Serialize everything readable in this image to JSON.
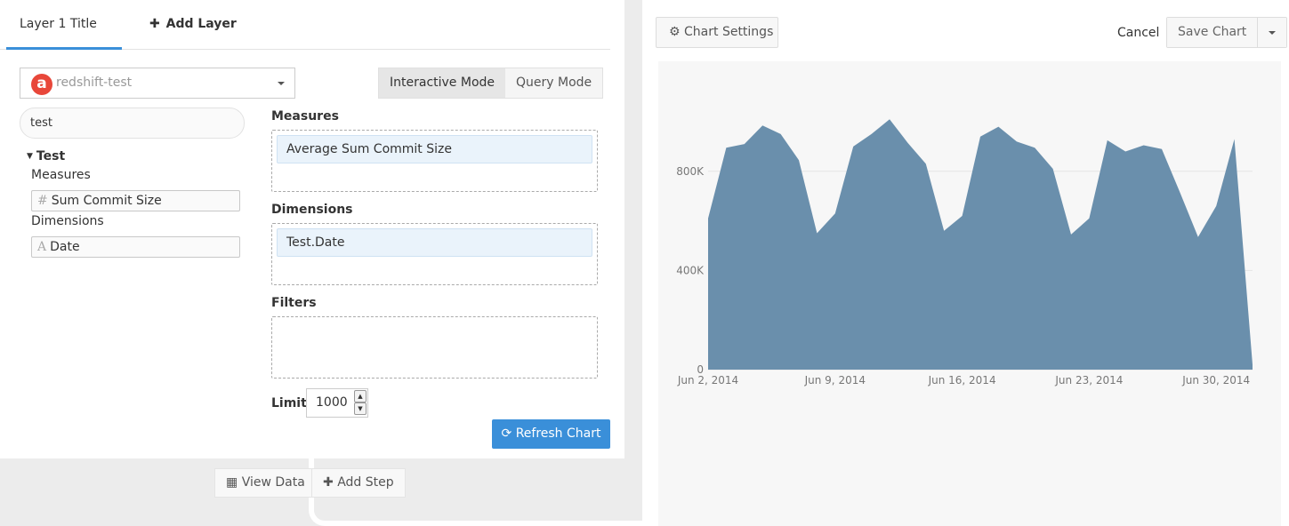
{
  "tabs": {
    "active_label": "Layer 1 Title",
    "add_label": "Add Layer"
  },
  "source": {
    "logo_letter": "a",
    "name": "redshift-test"
  },
  "modes": {
    "interactive": "Interactive Mode",
    "query": "Query Mode",
    "active": "interactive"
  },
  "search": {
    "value": "test"
  },
  "schema": {
    "table": "Test",
    "measures_heading": "Measures",
    "measure_field": "Sum Commit Size",
    "measure_icon": "#",
    "dimensions_heading": "Dimensions",
    "dimension_field": "Date",
    "dimension_icon": "A"
  },
  "query": {
    "measures_title": "Measures",
    "measure_item": "Average Sum Commit Size",
    "dimensions_title": "Dimensions",
    "dimension_item": "Test.Date",
    "filters_title": "Filters",
    "limit_label": "Limit",
    "limit_value": "1000",
    "refresh_label": "Refresh Chart"
  },
  "steps": {
    "view_data": "View Data",
    "add_step": "Add Step"
  },
  "toolbar": {
    "settings": "Chart Settings",
    "cancel": "Cancel",
    "save": "Save Chart"
  },
  "colors": {
    "accent": "#3a8fd9",
    "area_fill": "#6a8fac",
    "logo": "#e8473a"
  },
  "chart_data": {
    "type": "area",
    "x": [
      "2014-06-02",
      "2014-06-03",
      "2014-06-04",
      "2014-06-05",
      "2014-06-06",
      "2014-06-07",
      "2014-06-08",
      "2014-06-09",
      "2014-06-10",
      "2014-06-11",
      "2014-06-12",
      "2014-06-13",
      "2014-06-14",
      "2014-06-15",
      "2014-06-16",
      "2014-06-17",
      "2014-06-18",
      "2014-06-19",
      "2014-06-20",
      "2014-06-21",
      "2014-06-22",
      "2014-06-23",
      "2014-06-24",
      "2014-06-25",
      "2014-06-26",
      "2014-06-27",
      "2014-06-28",
      "2014-06-29",
      "2014-06-30"
    ],
    "values": [
      610000,
      895000,
      910000,
      985000,
      950000,
      845000,
      550000,
      630000,
      900000,
      950000,
      1010000,
      915000,
      830000,
      560000,
      620000,
      940000,
      980000,
      920000,
      895000,
      810000,
      545000,
      610000,
      925000,
      880000,
      905000,
      890000,
      715000,
      535000,
      660000,
      930000,
      20000
    ],
    "x_tick_labels": [
      "Jun 2, 2014",
      "Jun 9, 2014",
      "Jun 16, 2014",
      "Jun 23, 2014",
      "Jun 30, 2014"
    ],
    "y_tick_labels": [
      "0",
      "400K",
      "800K"
    ],
    "y_ticks": [
      0,
      400000,
      800000
    ],
    "ylim": [
      0,
      1000000
    ],
    "grid": true,
    "title": "",
    "xlabel": "",
    "ylabel": ""
  }
}
